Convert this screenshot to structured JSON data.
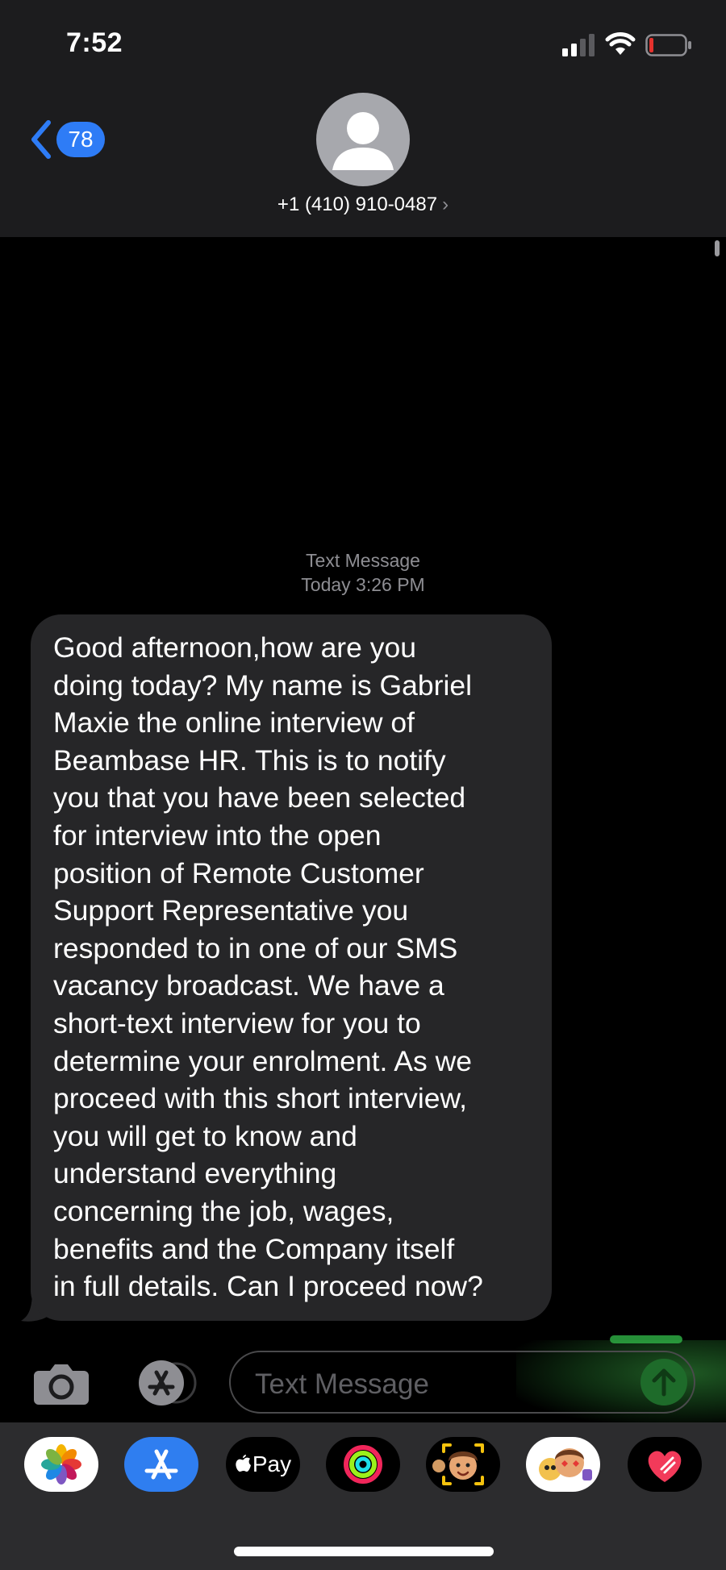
{
  "status_bar": {
    "time": "7:52",
    "battery_level": 0.08
  },
  "nav": {
    "back_count": "78",
    "contact": "+1 (410) 910-0487",
    "contact_arrow": "›"
  },
  "conversation": {
    "service": "Text Message",
    "timestamp": "Today 3:26 PM",
    "messages": [
      {
        "direction": "incoming",
        "text": "Good afternoon,how are you\ndoing today? My name is Gabriel\nMaxie the online interview of\nBeambase HR. This is to notify\nyou that you have been selected\nfor interview into the open\nposition of Remote Customer\nSupport Representative you\nresponded to in one of our SMS\nvacancy broadcast. We have a\nshort-text interview for you to\ndetermine your enrolment. As we\nproceed with this short interview,\nyou will get to know and\nunderstand everything\nconcerning the job, wages,\nbenefits and the Company itself\nin full details. Can I proceed now?"
      }
    ]
  },
  "composer": {
    "placeholder": "Text Message"
  },
  "app_tray": {
    "apps": [
      "photos-icon",
      "app-store-icon",
      "apple-pay-icon",
      "activity-icon",
      "memoji-icon",
      "memoji-stickers-icon",
      "digital-touch-icon"
    ],
    "apple_pay_label": "Pay"
  },
  "colors": {
    "accent": "#2e7cf6",
    "incoming_bubble": "#262628",
    "header_bg": "#1c1c1e",
    "send_green": "#1e6b2a",
    "battery_low": "#e5322d"
  }
}
